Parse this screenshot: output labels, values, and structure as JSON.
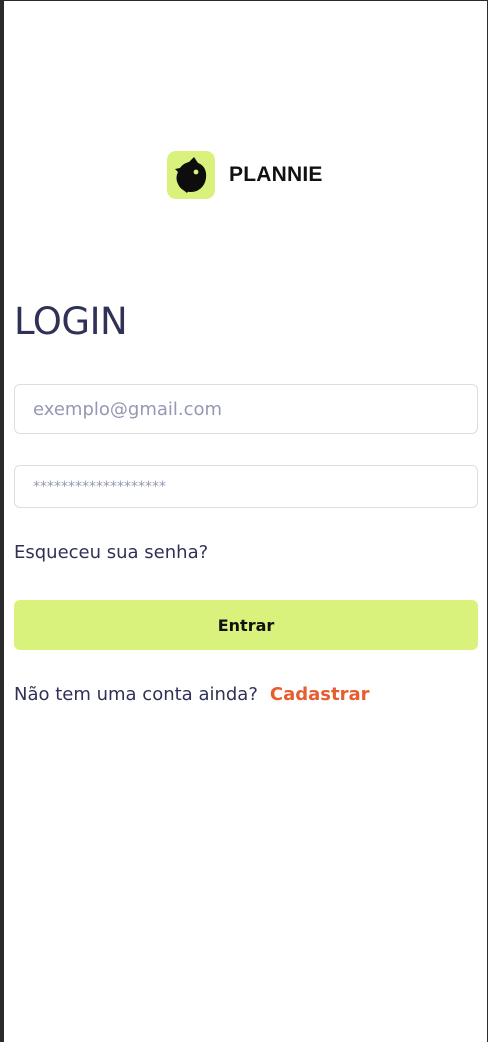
{
  "brand": {
    "name": "PLANNIE",
    "logo_icon": "cat-head-icon",
    "accent_color": "#d9f27c"
  },
  "login": {
    "title": "LOGIN",
    "email_placeholder": "exemplo@gmail.com",
    "password_placeholder": "*******************",
    "forgot_password_label": "Esqueceu sua senha?",
    "submit_label": "Entrar",
    "signup_prompt": "Não tem uma conta ainda?",
    "signup_link_label": "Cadastrar",
    "link_color": "#e85d30"
  }
}
